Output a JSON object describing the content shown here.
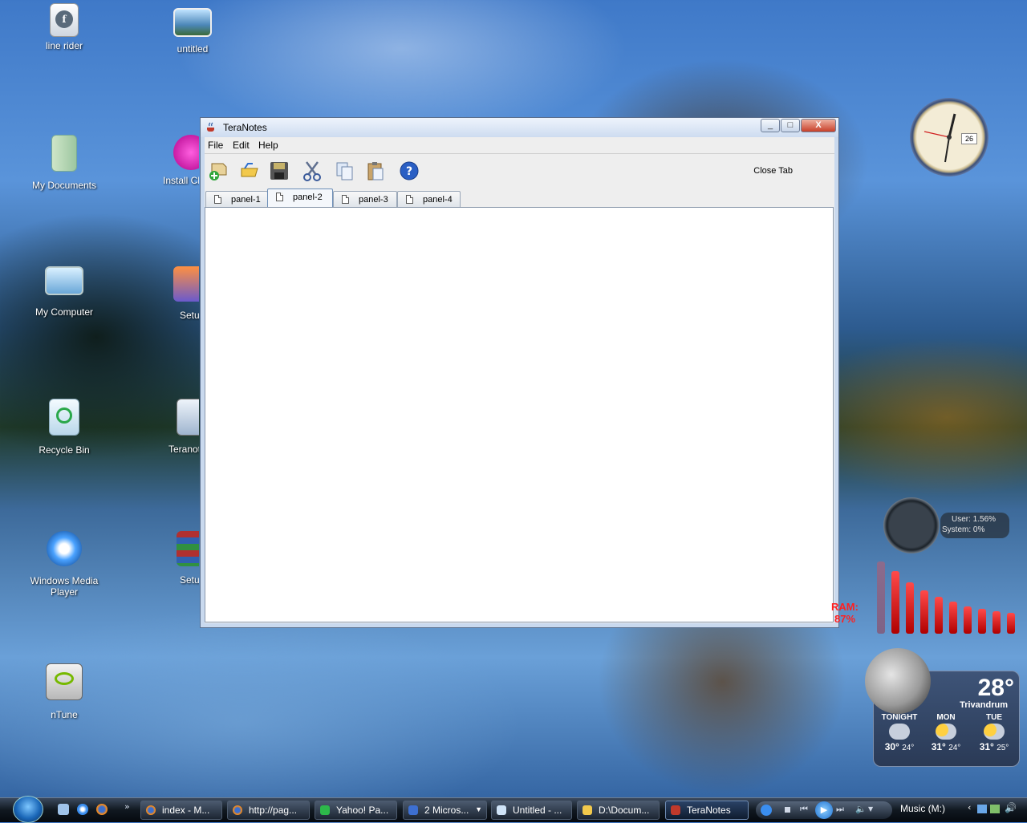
{
  "desktop": {
    "icons": [
      {
        "label": "line rider"
      },
      {
        "label": "untitled"
      },
      {
        "label": "My Documents"
      },
      {
        "label": "Install Cl"
      },
      {
        "label": "My Computer"
      },
      {
        "label": "Setu"
      },
      {
        "label": "Recycle Bin"
      },
      {
        "label": "Teranot"
      },
      {
        "label": "Windows Media Player"
      },
      {
        "label": "Setu"
      },
      {
        "label": "nTune"
      }
    ]
  },
  "window": {
    "title": "TeraNotes",
    "controls": {
      "minimize": "_",
      "maximize": "□",
      "close": "X"
    },
    "menu": [
      "File",
      "Edit",
      "Help"
    ],
    "toolbar": {
      "buttons": [
        "new-icon",
        "open-icon",
        "save-icon",
        "cut-icon",
        "copy-icon",
        "paste-icon",
        "help-icon"
      ],
      "close_tab": "Close Tab"
    },
    "tabs": [
      "panel-1",
      "panel-2",
      "panel-3",
      "panel-4"
    ],
    "active_tab": "panel-2"
  },
  "taskbar": {
    "items": [
      {
        "label": "index - M..."
      },
      {
        "label": "http://pag..."
      },
      {
        "label": "Yahoo! Pa..."
      },
      {
        "label": "2 Micros..."
      },
      {
        "label": "Untitled - ..."
      },
      {
        "label": "D:\\Docum..."
      },
      {
        "label": "TeraNotes"
      }
    ],
    "music_label": "Music (M:)"
  },
  "gadgets": {
    "clock": {
      "date": "26"
    },
    "cpu": {
      "user": "User: 1.56%",
      "system": "System: 0%"
    },
    "ram": {
      "label": "RAM:",
      "value": "87%"
    },
    "weather": {
      "temp": "28°",
      "city": "Trivandrum",
      "forecast": [
        {
          "day": "TONIGHT",
          "high": "30°",
          "low": "24°"
        },
        {
          "day": "MON",
          "high": "31°",
          "low": "24°"
        },
        {
          "day": "TUE",
          "high": "31°",
          "low": "25°"
        }
      ]
    }
  }
}
